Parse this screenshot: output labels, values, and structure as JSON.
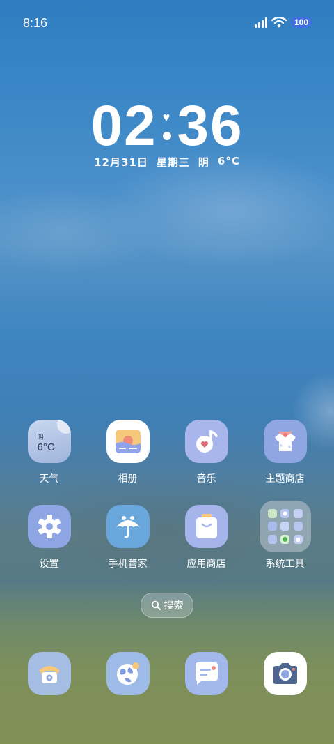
{
  "status_bar": {
    "time": "8:16",
    "battery": "100"
  },
  "clock": {
    "hours": "02",
    "minutes": "36",
    "date": "12月31日",
    "weekday": "星期三",
    "weather": "阴",
    "temp": "6°C"
  },
  "apps": [
    {
      "label": "天气",
      "icon": "weather-icon",
      "widget_condition": "阴",
      "widget_temp": "6°C"
    },
    {
      "label": "相册",
      "icon": "gallery-icon"
    },
    {
      "label": "音乐",
      "icon": "music-icon"
    },
    {
      "label": "主题商店",
      "icon": "theme-store-icon"
    },
    {
      "label": "设置",
      "icon": "gear-icon"
    },
    {
      "label": "手机管家",
      "icon": "umbrella-icon"
    },
    {
      "label": "应用商店",
      "icon": "shopping-bag-icon"
    },
    {
      "label": "系统工具",
      "icon": "folder-icon"
    }
  ],
  "search": {
    "label": "搜索"
  },
  "dock": [
    {
      "icon": "phone-icon"
    },
    {
      "icon": "browser-globe-icon"
    },
    {
      "icon": "message-icon"
    },
    {
      "icon": "camera-icon"
    }
  ],
  "colors": {
    "icon_lavender": "#aab8ea",
    "icon_blue": "#8aa6e0",
    "battery": "#3f6fe0"
  }
}
